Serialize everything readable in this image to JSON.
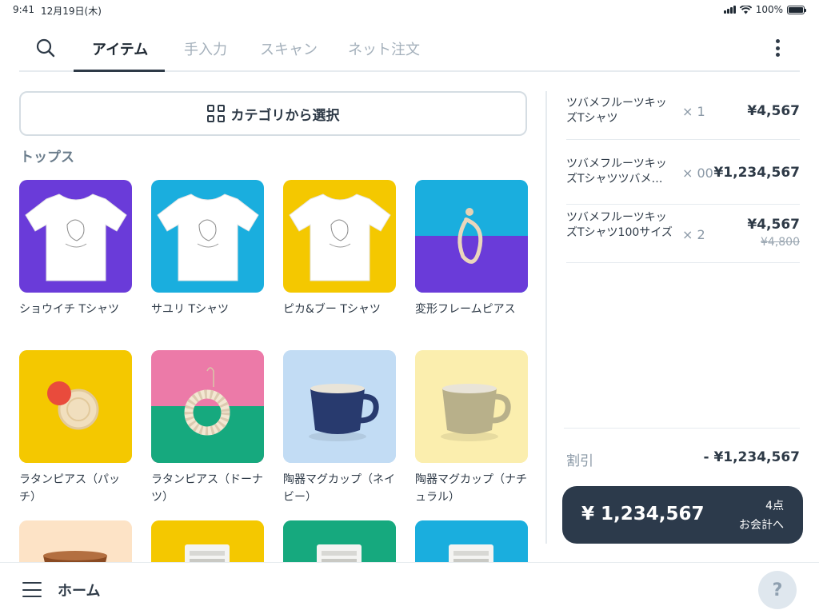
{
  "status_bar": {
    "time": "9:41",
    "date": "12月19日(木)",
    "battery": "100%"
  },
  "tabs": [
    {
      "label": "アイテム",
      "active": true
    },
    {
      "label": "手入力",
      "active": false
    },
    {
      "label": "スキャン",
      "active": false
    },
    {
      "label": "ネット注文",
      "active": false
    }
  ],
  "category_button": {
    "label": "カテゴリから選択"
  },
  "section_title": "トップス",
  "items": [
    {
      "name": "ショウイチ Tシャツ",
      "bg": "#6a3bd9",
      "kind": "tshirt"
    },
    {
      "name": "サユリ Tシャツ",
      "bg": "#1aaede",
      "kind": "tshirt"
    },
    {
      "name": "ピカ&ブー Tシャツ",
      "bg": "#f4c800",
      "kind": "tshirt"
    },
    {
      "name": "変形フレームピアス",
      "bg": "#1aaede",
      "bg2": "#6a3bd9",
      "kind": "earring-frame"
    },
    {
      "name": "ラタンピアス（パッチ）",
      "bg": "#f4c800",
      "kind": "rattan-dot"
    },
    {
      "name": "ラタンピアス（ドーナツ）",
      "bg": "#ec7aa8",
      "bg2": "#16a97e",
      "kind": "rattan-donut"
    },
    {
      "name": "陶器マグカップ（ネイビー）",
      "bg": "#c2dcf4",
      "mug": "#283a6e",
      "kind": "mug"
    },
    {
      "name": "陶器マグカップ（ナチュラル）",
      "bg": "#fbeeae",
      "mug": "#b8b08a",
      "kind": "mug"
    },
    {
      "name": "",
      "bg": "#fde3c6",
      "mug": "#8a4a22",
      "kind": "bowl"
    },
    {
      "name": "",
      "bg": "#f4c800",
      "kind": "bag"
    },
    {
      "name": "",
      "bg": "#16a97e",
      "kind": "bag"
    },
    {
      "name": "",
      "bg": "#1aaede",
      "kind": "bag"
    }
  ],
  "cart": {
    "lines": [
      {
        "name": "ツバメフルーツキッズTシャツ",
        "qty": "× 1",
        "price": "¥4,567",
        "original_price": ""
      },
      {
        "name": "ツバメフルーツキッズTシャツツバメ…",
        "qty": "× 00",
        "price": "¥1,234,567",
        "original_price": ""
      },
      {
        "name": "ツバメフルーツキッズTシャツ100サイズ",
        "qty": "× 2",
        "price": "¥4,567",
        "original_price": "¥4,800"
      }
    ],
    "discount_label": "割引",
    "discount_value": "- ¥1,234,567",
    "total": "¥ 1,234,567",
    "count": "4点",
    "checkout_label": "お会計へ"
  },
  "bottom_bar": {
    "home_label": "ホーム",
    "help_label": "?"
  }
}
